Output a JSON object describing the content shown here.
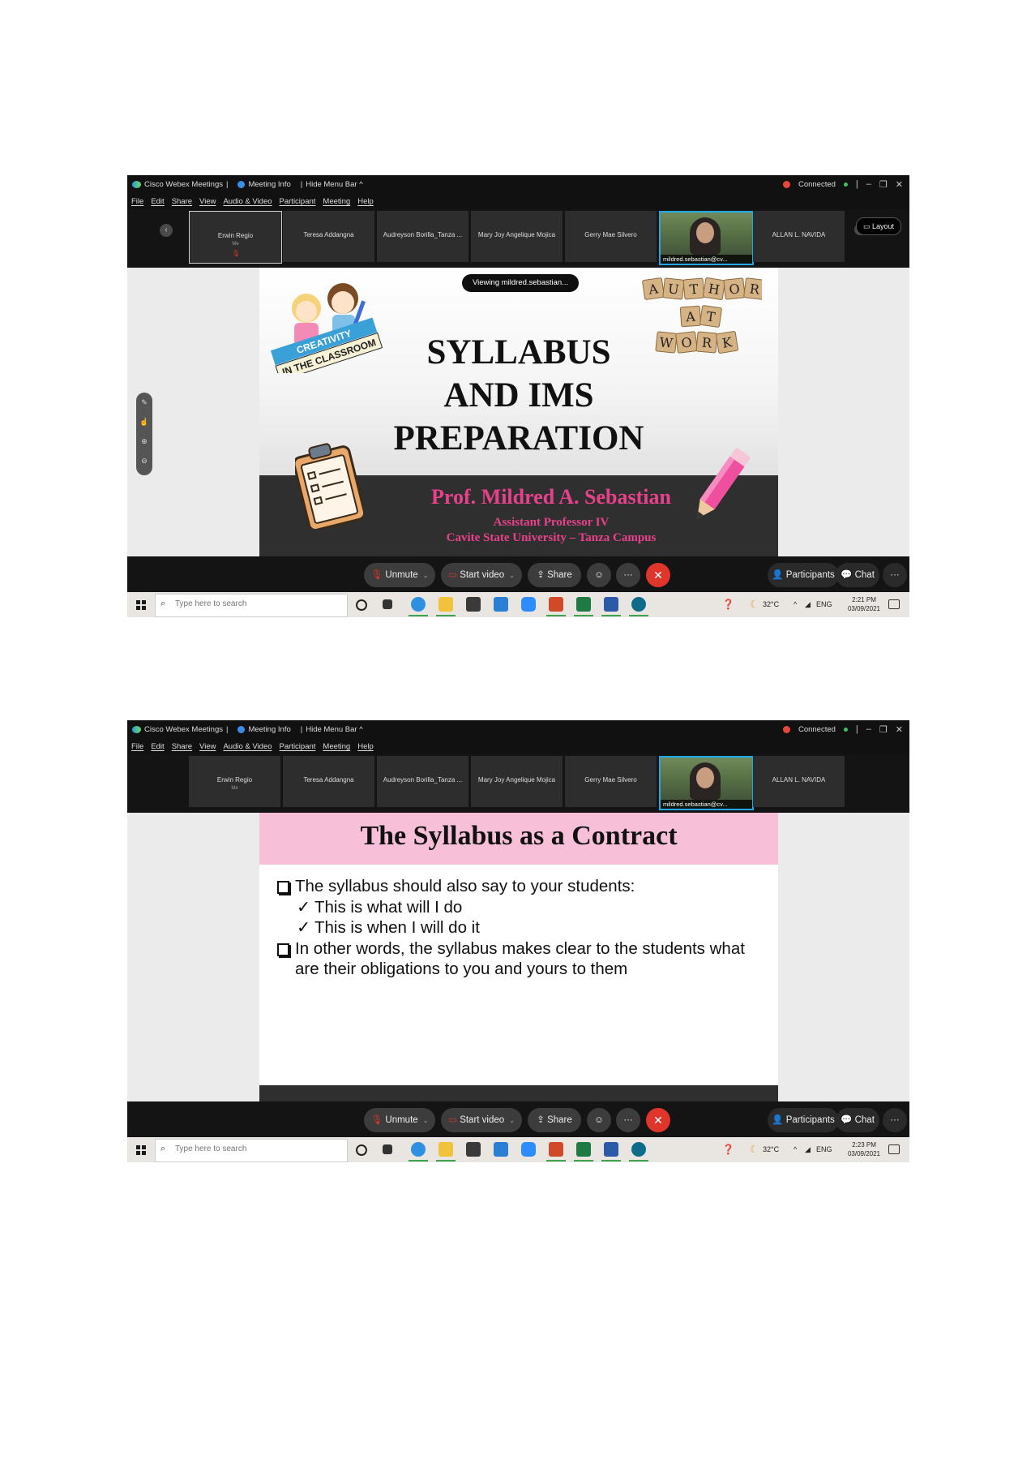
{
  "screens": [
    {
      "titlebar": {
        "app": "Cisco Webex Meetings",
        "info": "Meeting Info",
        "hide": "Hide Menu Bar ^",
        "connected": "Connected"
      },
      "menu": [
        "File",
        "Edit",
        "Share",
        "View",
        "Audio & Video",
        "Participant",
        "Meeting",
        "Help"
      ],
      "participants": [
        {
          "name": "Erwin Regio",
          "sub": "Me"
        },
        {
          "name": "Teresa Addangna",
          "sub": ""
        },
        {
          "name": "Audreyson Borilla_Tanza ...",
          "sub": ""
        },
        {
          "name": "Mary Joy Angelique Mojica",
          "sub": ""
        },
        {
          "name": "Gerry Mae Silvero",
          "sub": ""
        },
        {
          "name": "",
          "sub": "",
          "caption": "mildred.sebastian@cv..."
        },
        {
          "name": "ALLAN L. NAVIDA",
          "sub": ""
        }
      ],
      "layout_label": "Layout",
      "viewing": "Viewing mildred.sebastian...",
      "slide": {
        "title": "SYLLABUS\nAND IMS\nPREPARATION",
        "badge_top": "CREATIVITY",
        "badge_bottom": "IN THE CLASSROOM",
        "tiles": [
          "A",
          "U",
          "T",
          "H",
          "O",
          "R",
          "A",
          "T",
          "W",
          "O",
          "R",
          "K"
        ],
        "presenter": "Prof. Mildred A. Sebastian",
        "position": "Assistant Professor IV",
        "campus": "Cavite State University – Tanza Campus"
      },
      "controls": {
        "unmute": "Unmute",
        "start_video": "Start video",
        "share": "Share",
        "participants": "Participants",
        "chat": "Chat",
        "more": "···"
      },
      "taskbar": {
        "search_placeholder": "Type here to search",
        "temp": "32°C",
        "lang": "ENG",
        "time": "2:21 PM",
        "date": "03/09/2021"
      }
    },
    {
      "titlebar": {
        "app": "Cisco Webex Meetings",
        "info": "Meeting Info",
        "hide": "Hide Menu Bar ^",
        "connected": "Connected"
      },
      "menu": [
        "File",
        "Edit",
        "Share",
        "View",
        "Audio & Video",
        "Participant",
        "Meeting",
        "Help"
      ],
      "participants": [
        {
          "name": "Erwin Regio",
          "sub": "Me"
        },
        {
          "name": "Teresa Addangna",
          "sub": ""
        },
        {
          "name": "Audreyson Borilla_Tanza ...",
          "sub": ""
        },
        {
          "name": "Mary Joy Angelique Mojica",
          "sub": ""
        },
        {
          "name": "Gerry Mae Silvero",
          "sub": ""
        },
        {
          "name": "",
          "sub": "",
          "caption": "mildred.sebastian@cv..."
        },
        {
          "name": "ALLAN L. NAVIDA",
          "sub": ""
        }
      ],
      "slide": {
        "title": "The Syllabus as a Contract",
        "bullet1": "The syllabus should also say to your students:",
        "check1": "This is what will I do",
        "check2": "This is when I will do it",
        "bullet2": "In other words, the syllabus makes clear to the students what are their obligations to you and yours to them"
      },
      "controls": {
        "unmute": "Unmute",
        "start_video": "Start video",
        "share": "Share",
        "participants": "Participants",
        "chat": "Chat",
        "more": "···"
      },
      "taskbar": {
        "search_placeholder": "Type here to search",
        "temp": "32°C",
        "lang": "ENG",
        "time": "2:23 PM",
        "date": "03/09/2021"
      }
    }
  ]
}
